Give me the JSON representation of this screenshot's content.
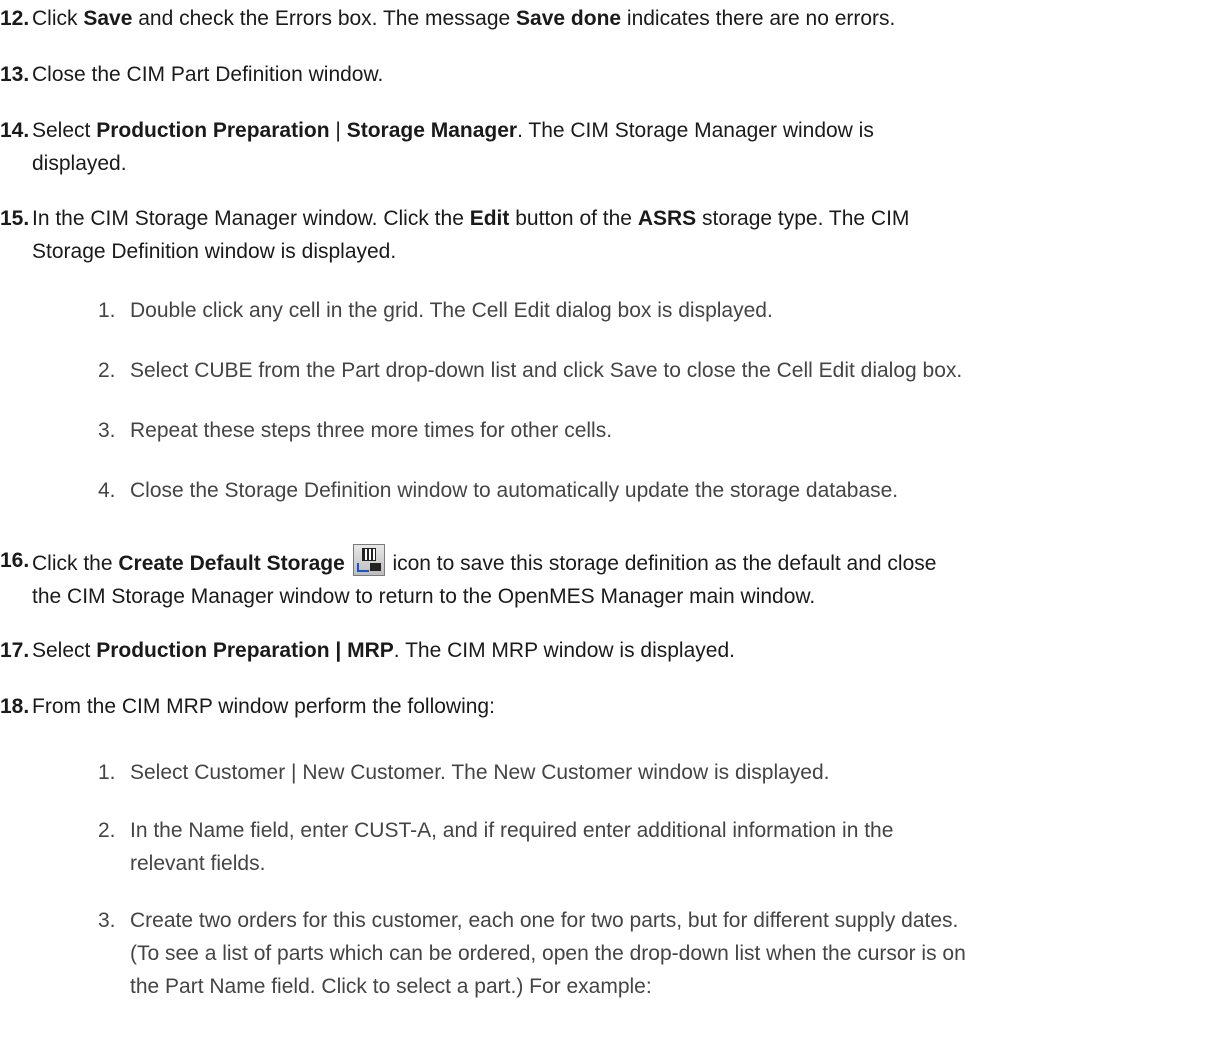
{
  "steps": {
    "s12": {
      "num": "12.",
      "t1": "Click ",
      "b1": "Save",
      "t2": " and check the Errors box. The message ",
      "b2": "Save done",
      "t3": " indicates there are no errors."
    },
    "s13": {
      "num": "13.",
      "t1": "Close the CIM Part Definition window."
    },
    "s14": {
      "num": "14.",
      "t1": "Select ",
      "b1": "Production Preparation",
      "t2": " | ",
      "b2": "Storage Manager",
      "t3": ". The CIM Storage Manager window is",
      "t4": "displayed."
    },
    "s15": {
      "num": "15.",
      "t1": "In the CIM Storage Manager window. Click the ",
      "b1": "Edit",
      "t2": " button of the ",
      "b2": "ASRS",
      "t3": " storage type. The CIM",
      "t4": "Storage Definition window is displayed.",
      "subs": [
        {
          "num": "1.",
          "text": "Double click any cell in the grid. The Cell Edit dialog box is displayed."
        },
        {
          "num": "2.",
          "text": "Select CUBE from the Part drop-down list and click Save to close the Cell Edit dialog box."
        },
        {
          "num": "3.",
          "text": "Repeat these steps three more times for other cells."
        },
        {
          "num": "4.",
          "text": "Close the Storage Definition window to automatically update the storage database."
        }
      ]
    },
    "s16": {
      "num": "16.",
      "t1": "Click the ",
      "b1": "Create Default Storage",
      "t2": " icon to save this storage definition as the default and close",
      "t3": "the CIM Storage Manager window to return to the OpenMES Manager main window.",
      "icon": "create-default-storage-icon"
    },
    "s17": {
      "num": "17.",
      "t1": "Select ",
      "b1": "Production Preparation | MRP",
      "t2": ". The CIM MRP window is displayed."
    },
    "s18": {
      "num": "18.",
      "t1": "From the CIM MRP window perform the following:",
      "subs": [
        {
          "num": "1.",
          "lines": [
            "Select Customer | New Customer. The New Customer window is displayed."
          ]
        },
        {
          "num": "2.",
          "lines": [
            "In the Name field, enter CUST-A, and if required enter additional information in the",
            "relevant fields."
          ]
        },
        {
          "num": "3.",
          "lines": [
            "Create two orders for this customer, each one for two parts, but for different supply dates.",
            "(To see a list of parts which can be ordered, open the drop-down list when the cursor is on",
            "the Part Name field. Click to select a part.) For example:"
          ]
        }
      ]
    }
  }
}
